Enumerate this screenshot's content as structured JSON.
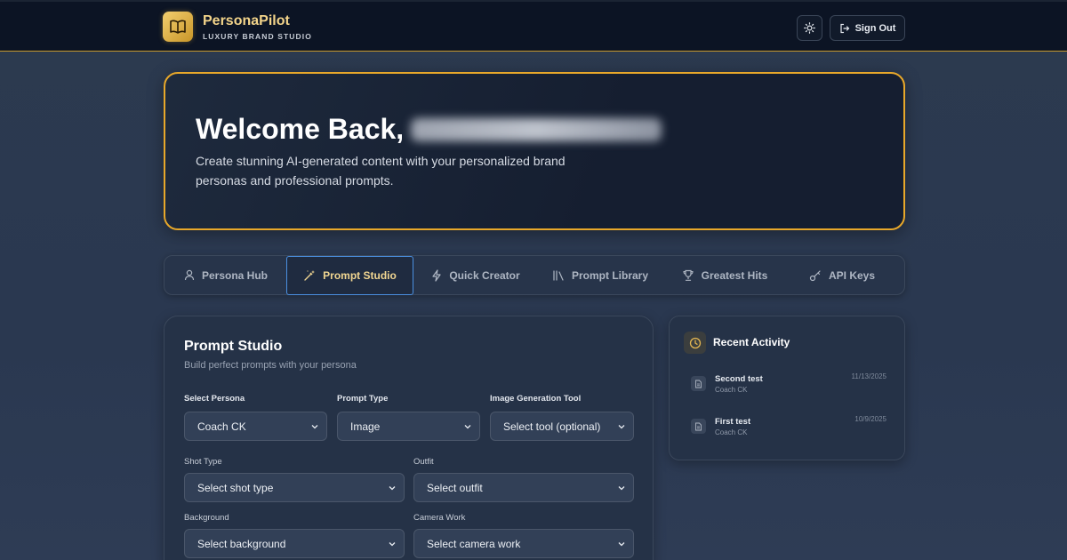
{
  "app": {
    "name": "PersonaPilot",
    "tagline": "LUXURY BRAND STUDIO",
    "logo_icon": "book-open-icon",
    "theme_toggle_icon": "sun-icon",
    "sign_out_label": "Sign Out",
    "accent_color": "#e8a82a"
  },
  "hero": {
    "title": "Welcome Back,",
    "subtitle": "Create stunning AI-generated content with your personalized brand personas and professional prompts."
  },
  "tabs": [
    {
      "label": "Persona Hub",
      "icon": "user-icon"
    },
    {
      "label": "Prompt Studio",
      "icon": "magic-wand-icon",
      "active": true
    },
    {
      "label": "Quick Creator",
      "icon": "lightning-icon"
    },
    {
      "label": "Prompt Library",
      "icon": "library-icon"
    },
    {
      "label": "Greatest Hits",
      "icon": "trophy-icon"
    },
    {
      "label": "API Keys",
      "icon": "key-icon"
    }
  ],
  "prompt_studio": {
    "title": "Prompt Studio",
    "subtitle": "Build perfect prompts with your persona",
    "fields": {
      "persona": {
        "label": "Select Persona",
        "value": "Coach CK"
      },
      "prompt_type": {
        "label": "Prompt Type",
        "value": "Image"
      },
      "image_tool": {
        "label": "Image Generation Tool",
        "value": "Select tool (optional)"
      },
      "shot_type": {
        "label": "Shot Type",
        "value": "Select shot type"
      },
      "outfit": {
        "label": "Outfit",
        "value": "Select outfit"
      },
      "background": {
        "label": "Background",
        "value": "Select background"
      },
      "camera_work": {
        "label": "Camera Work",
        "value": "Select camera work"
      }
    }
  },
  "recent_activity": {
    "title": "Recent Activity",
    "icon": "clock-icon",
    "items": [
      {
        "name": "Second test",
        "persona": "Coach CK",
        "date": "11/13/2025"
      },
      {
        "name": "First test",
        "persona": "Coach CK",
        "date": "10/9/2025"
      }
    ]
  }
}
